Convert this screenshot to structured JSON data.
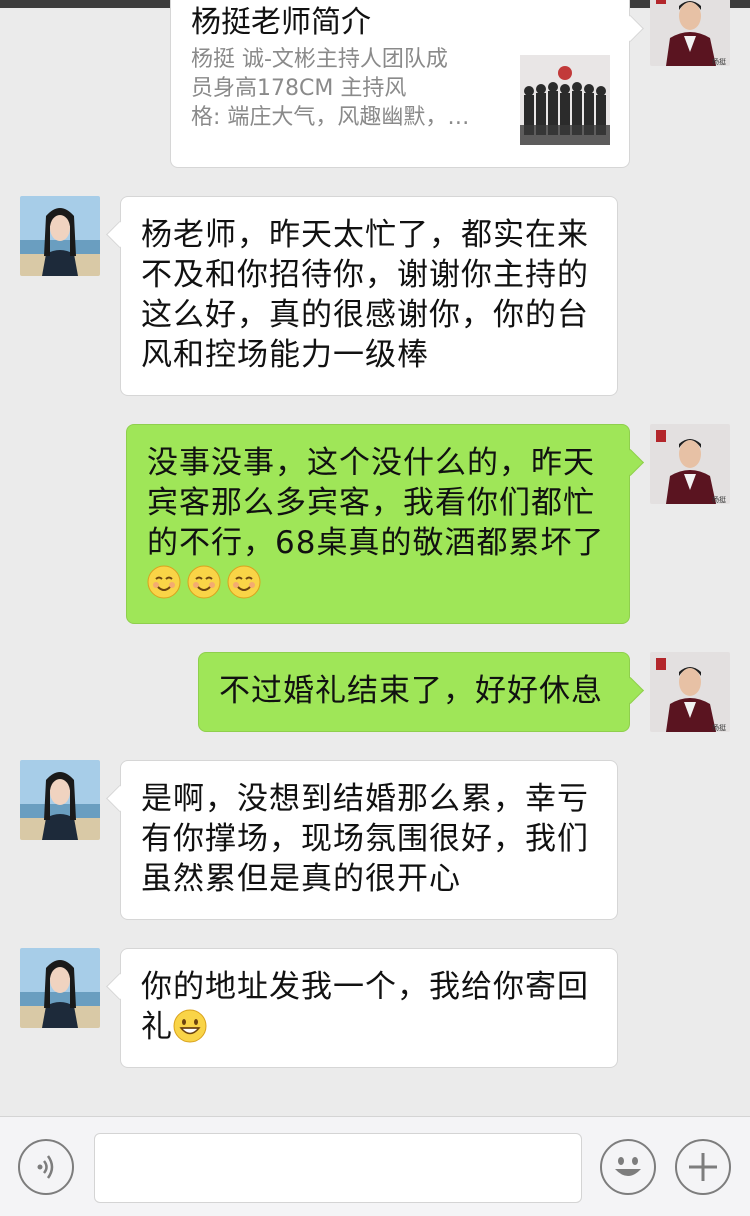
{
  "card": {
    "title": "杨挺老师简介",
    "description": "杨挺   诚-文彬主持人团队成\n员身高178CM          主持风\n格: 端庄大气，风趣幽默，…"
  },
  "messages": [
    {
      "side": "left",
      "text": "杨老师，昨天太忙了，都实在来不及和你招待你，谢谢你主持的这么好，真的很感谢你，你的台风和控场能力一级棒",
      "emoji_count": 0
    },
    {
      "side": "right",
      "text": "没事没事，这个没什么的，昨天宾客那么多宾客，我看你们都忙的不行，68桌真的敬酒都累坏了",
      "emoji": "smiling-blush-emoji",
      "emoji_count": 3
    },
    {
      "side": "right",
      "text": "不过婚礼结束了，好好休息",
      "emoji_count": 0
    },
    {
      "side": "left",
      "text": "是啊，没想到结婚那么累，幸亏有你撑场，现场氛围很好，我们虽然累但是真的很开心",
      "emoji_count": 0
    },
    {
      "side": "left",
      "text": "你的地址发我一个，我给你寄回礼",
      "emoji": "grinning-emoji",
      "emoji_count": 1
    }
  ],
  "host_avatar_caption": "杨挺",
  "input": {
    "placeholder": "",
    "value": ""
  },
  "icons": {
    "voice": "voice-icon",
    "emoji": "emoji-icon",
    "more": "plus-icon"
  },
  "colors": {
    "background": "#ebebeb",
    "sent_bubble": "#9fe658",
    "received_bubble": "#ffffff",
    "input_bar": "#f4f4f6"
  }
}
